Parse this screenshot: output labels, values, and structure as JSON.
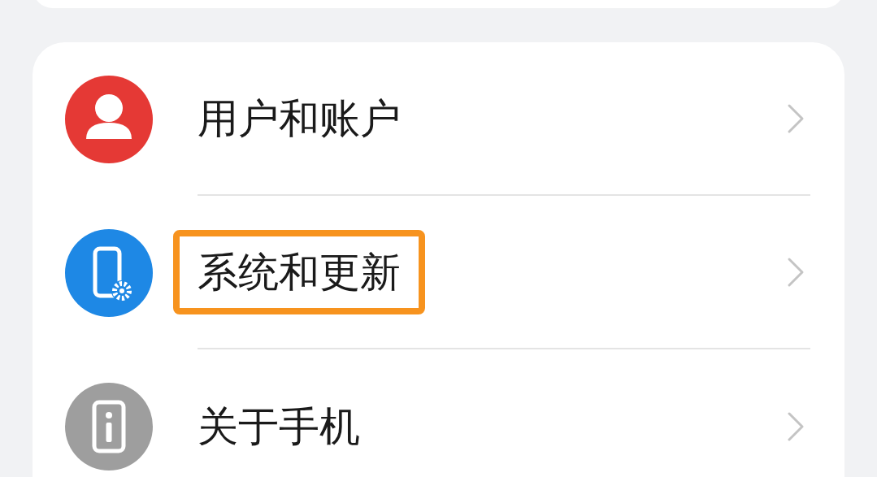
{
  "settings": [
    {
      "label": "用户和账户",
      "kind": "account",
      "color": "#e53935",
      "highlighted": false
    },
    {
      "label": "系统和更新",
      "kind": "system",
      "color": "#1e88e5",
      "highlighted": true
    },
    {
      "label": "关于手机",
      "kind": "about",
      "color": "#9e9e9e",
      "highlighted": false
    }
  ]
}
